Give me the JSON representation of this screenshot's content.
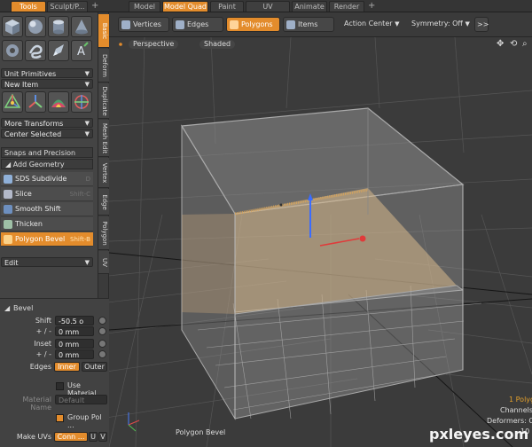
{
  "left_tabs": [
    {
      "label": "Tools",
      "active": true
    },
    {
      "label": "Sculpt/P...",
      "active": false
    }
  ],
  "top_tabs": [
    {
      "label": "Model",
      "active": false
    },
    {
      "label": "Model Quad",
      "active": true
    },
    {
      "label": "Paint",
      "active": false
    },
    {
      "label": "UV",
      "active": false
    },
    {
      "label": "Animate",
      "active": false
    },
    {
      "label": "Render",
      "active": false
    }
  ],
  "plus_label": "+",
  "icon_buttons_row1": [
    "cube-icon",
    "sphere-icon",
    "cylinder-icon",
    "cone-icon"
  ],
  "icon_buttons_row2": [
    "capsule-icon",
    "spiral-icon",
    "pen-icon",
    "text-icon"
  ],
  "icon_buttons_row3": [
    "move-icon",
    "rotate-icon",
    "scale-icon",
    "transform-icon"
  ],
  "text_tool_glyph": "A",
  "dropdowns": {
    "unit_primitives": "Unit Primitives",
    "new_item": "New Item",
    "more_transforms": "More Transforms",
    "center_selected": "Center Selected",
    "edit": "Edit"
  },
  "sections": {
    "snaps": "Snaps and Precision",
    "add_geometry": "Add Geometry"
  },
  "tools": [
    {
      "label": "SDS Subdivide",
      "shortcut": "D",
      "selected": false,
      "icon": "sds-icon"
    },
    {
      "label": "Slice",
      "shortcut": "Shift-C",
      "selected": false,
      "icon": "slice-icon"
    },
    {
      "label": "Smooth Shift",
      "shortcut": "",
      "selected": false,
      "icon": "smooth-shift-icon"
    },
    {
      "label": "Thicken",
      "shortcut": "",
      "selected": false,
      "icon": "thicken-icon"
    },
    {
      "label": "Polygon Bevel",
      "shortcut": "Shift-B",
      "selected": true,
      "icon": "polygon-bevel-icon"
    }
  ],
  "side_tabs": [
    {
      "label": "Basic",
      "active": true
    },
    {
      "label": "Deform",
      "active": false
    },
    {
      "label": "Duplicate",
      "active": false
    },
    {
      "label": "Mesh Edit",
      "active": false
    },
    {
      "label": "Vertex",
      "active": false
    },
    {
      "label": "Edge",
      "active": false
    },
    {
      "label": "Polygon",
      "active": false
    },
    {
      "label": "UV",
      "active": false
    }
  ],
  "bevel_panel": {
    "title": "Bevel",
    "shift_label": "Shift",
    "shift_value": "-50.5 o",
    "pm_label": "+ / -",
    "shift_pm_value": "0 mm",
    "inset_label": "Inset",
    "inset_value": "0 mm",
    "inset_pm_value": "0 mm",
    "edges_label": "Edges",
    "edges_inner": "Inner",
    "edges_outer": "Outer",
    "use_material_label": "Use Material",
    "material_name_label": "Material Name",
    "material_name_value": "Default",
    "group_label": "Group Pol ...",
    "make_uvs_label": "Make UVs",
    "make_uvs_value": "Conn ...",
    "u_label": "U",
    "v_label": "V"
  },
  "selection_modes": [
    {
      "label": "Vertices",
      "active": false
    },
    {
      "label": "Edges",
      "active": false
    },
    {
      "label": "Polygons",
      "active": true
    },
    {
      "label": "Items",
      "active": false
    }
  ],
  "action_center": "Action Center",
  "symmetry": "Symmetry: Off",
  "more_glyph": ">>",
  "viewport": {
    "projection": "Perspective",
    "shading": "Shaded",
    "tool_label": "Polygon Bevel",
    "info_polys": "1 Polyg",
    "info_channels": "Channels",
    "info_deformers": "Deformers: O",
    "info_extra": "10"
  },
  "watermark": "pxleyes.com",
  "colors": {
    "accent": "#e38c2c",
    "handle_blue": "#3a6cff",
    "handle_red": "#e03a3a"
  }
}
